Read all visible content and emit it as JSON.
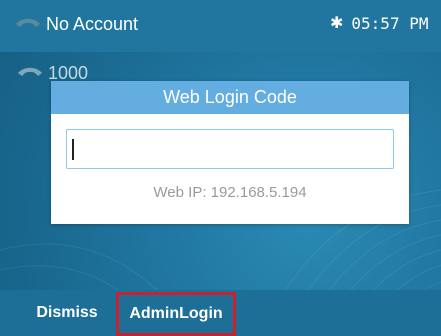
{
  "status_bar": {
    "account_text": "No Account",
    "bluetooth_icon": "bluetooth-icon",
    "time": "05:57 PM"
  },
  "line": {
    "number": "1000",
    "icon": "phone-handset-icon"
  },
  "dialog": {
    "title": "Web Login Code",
    "input_value": "",
    "web_ip": "Web IP: 192.168.5.194"
  },
  "softkeys": {
    "dismiss_label": "Dismiss",
    "admin_login_label": "AdminLogin"
  },
  "colors": {
    "dialog_header": "#63ade0",
    "highlight_border": "#c8232c",
    "background": "#1d6f98"
  }
}
